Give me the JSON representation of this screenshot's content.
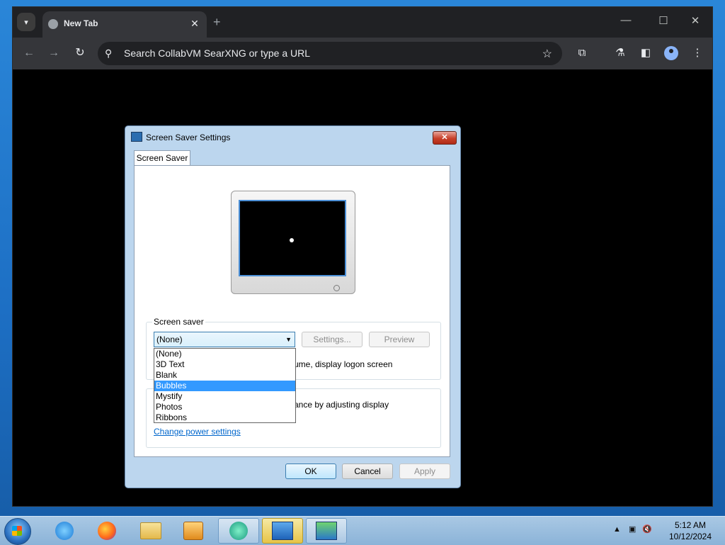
{
  "browser": {
    "tab": {
      "title": "New Tab",
      "close": "✕"
    },
    "new_tab": "+",
    "window_controls": {
      "minimize": "—",
      "maximize": "☐",
      "close": "✕"
    },
    "nav": {
      "back": "←",
      "forward": "→",
      "reload": "↻"
    },
    "omnibox_text": "Search CollabVM SearXNG or type a URL"
  },
  "dialog": {
    "title": "Screen Saver Settings",
    "tab_label": "Screen Saver",
    "screen_saver_group_label": "Screen saver",
    "selected_value": "(None)",
    "settings_button": "Settings...",
    "preview_button": "Preview",
    "logon_partial": "ume, display logon screen",
    "power_partial": "ance by adjusting display",
    "power_link": "Change power settings",
    "dropdown_options": [
      "(None)",
      "3D Text",
      "Blank",
      "Bubbles",
      "Mystify",
      "Photos",
      "Ribbons"
    ],
    "ok_button": "OK",
    "cancel_button": "Cancel",
    "apply_button": "Apply"
  },
  "taskbar": {
    "clock_time": "5:12 AM",
    "clock_date": "10/12/2024",
    "apps": [
      "internet-explorer",
      "firefox",
      "file-explorer",
      "media-player",
      "collabvm-browser",
      "control-panel",
      "display-settings"
    ]
  },
  "colors": {
    "selection": "#3399ff",
    "link": "#0066cc",
    "browser_dark": "#202124"
  }
}
